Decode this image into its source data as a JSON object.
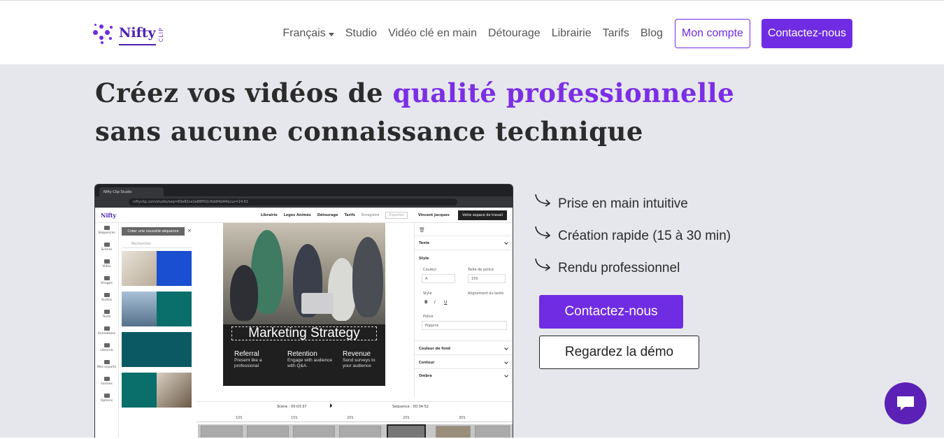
{
  "brand": {
    "name": "Nifty",
    "sub": "CLIP",
    "accent": "#6f2ce3"
  },
  "nav": {
    "items": [
      "Français",
      "Studio",
      "Vidéo clé en main",
      "Détourage",
      "Librairie",
      "Tarifs",
      "Blog"
    ],
    "account": "Mon compte",
    "contact": "Contactez-nous"
  },
  "hero": {
    "title_before": "Créez vos vidéos de ",
    "title_accent": "qualité professionnelle",
    "title_after": " sans aucune connaissance technique"
  },
  "screenshot": {
    "tab_title": "Nifty Clip Studio",
    "url": "niftyclip.com/studio/seq=60e82ce1e88ff02c6ddf4d44&cur=24:61",
    "menu": [
      "Librairie",
      "Logos Animés",
      "Détourage",
      "Tarifs",
      "Enregistré"
    ],
    "export": "Exporter",
    "user": "Vincent Jacques",
    "workspace": "Votre espace de travail",
    "sidebar": [
      "Séquences",
      "Scènes",
      "Vidéo",
      "Images",
      "Audios",
      "Texte",
      "Animations",
      "Librairie",
      "Mes exports",
      "Formes",
      "Options"
    ],
    "new_sequence": "Créer une nouvelle séquence",
    "search_placeholder": "Rechercher",
    "slide_title": "Marketing Strategy",
    "columns": [
      {
        "head": "Referral",
        "body": "Present like a professional"
      },
      {
        "head": "Retention",
        "body": "Engage with audience with Q&A."
      },
      {
        "head": "Revenue",
        "body": "Send surveys to your audience"
      }
    ],
    "props": {
      "texte": "Texte",
      "style": "Style",
      "couleur": "Couleur",
      "taille": "Taille de police",
      "taille_val": "150",
      "style_label": "Style",
      "alignement": "Alignement du texte",
      "police": "Police",
      "police_val": "Poppins",
      "fond": "Couleur de fond",
      "contour": "Contour",
      "ombre": "Ombre"
    },
    "timeline": {
      "scene": "Scène : 00:03:37",
      "sequence": "Séquence : 00:34:52",
      "ticks": [
        "10S",
        "15S",
        "20S",
        "25S",
        "30S"
      ]
    }
  },
  "features": [
    "Prise en main intuitive",
    "Création rapide (15 à 30 min)",
    "Rendu professionnel"
  ],
  "cta": {
    "primary": "Contactez-nous",
    "secondary": "Regardez la démo"
  }
}
